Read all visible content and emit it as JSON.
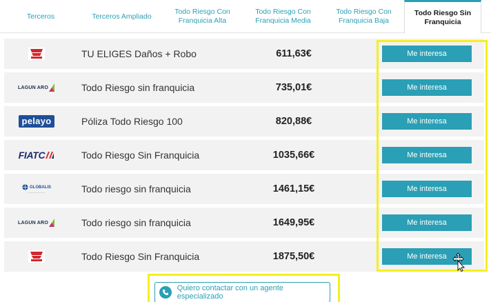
{
  "tabs": [
    {
      "label": "Terceros"
    },
    {
      "label": "Terceros Ampliado"
    },
    {
      "label": "Todo Riesgo Con Franquicia Alta"
    },
    {
      "label": "Todo Riesgo Con Franquicia Media"
    },
    {
      "label": "Todo Riesgo Con Franquicia Baja"
    },
    {
      "label": "Todo Riesgo Sin Franquicia"
    }
  ],
  "active_tab": "Todo Riesgo Sin Franquicia",
  "offers": [
    {
      "insurer": "Generali",
      "insurer_icon": "generali-logo",
      "product": "TU ELIGES Daños + Robo",
      "price": "611,63€",
      "cta": "Me interesa"
    },
    {
      "insurer": "LAGUN ARO",
      "insurer_icon": "lagun-aro-logo",
      "product": "Todo Riesgo sin franquicia",
      "price": "735,01€",
      "cta": "Me interesa"
    },
    {
      "insurer": "pelayo",
      "insurer_icon": "pelayo-logo",
      "product": "Póliza Todo Riesgo 100",
      "price": "820,88€",
      "cta": "Me interesa"
    },
    {
      "insurer": "FIATC",
      "insurer_icon": "fiatc-logo",
      "product": "Todo Riesgo Sin Franquicia",
      "price": "1035,66€",
      "cta": "Me interesa"
    },
    {
      "insurer": "GLOBALIS",
      "insurer_icon": "globalis-logo",
      "product": "Todo riesgo sin franquicia",
      "price": "1461,15€",
      "cta": "Me interesa"
    },
    {
      "insurer": "LAGUN ARO",
      "insurer_icon": "lagun-aro-logo",
      "product": "Todo riesgo sin franquicia",
      "price": "1649,95€",
      "cta": "Me interesa"
    },
    {
      "insurer": "Generali",
      "insurer_icon": "generali-logo",
      "product": "Todo Riesgo Sin Franquicia",
      "price": "1875,50€",
      "cta": "Me interesa"
    }
  ],
  "contact": {
    "label": "Quiero contactar con un agente especializado",
    "icon": "phone-icon"
  },
  "colors": {
    "accent": "#2a9fb5",
    "highlight": "#f4ef21",
    "row_bg": "#f2f2f2"
  }
}
